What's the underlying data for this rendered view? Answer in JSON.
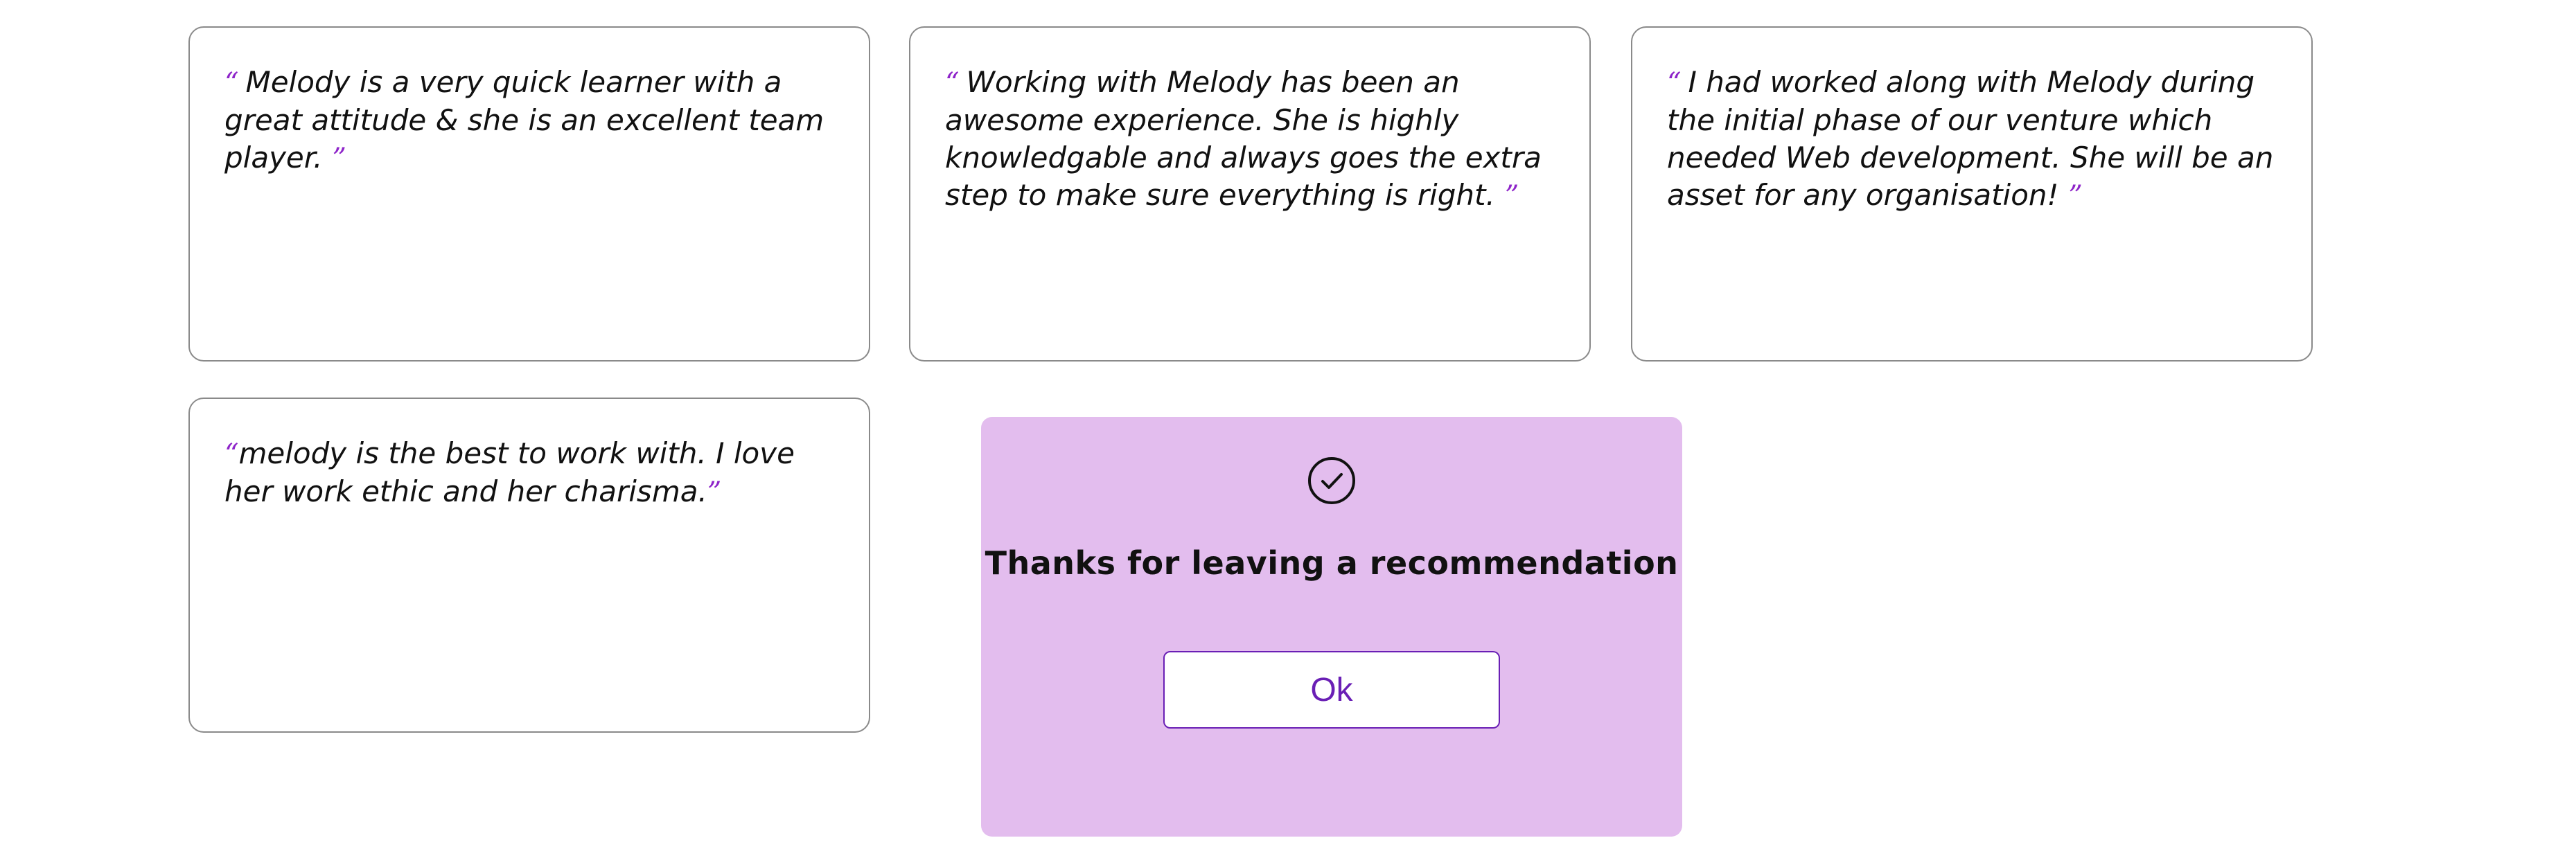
{
  "testimonials": [
    {
      "open_quote": "“",
      "text": "Melody is a very quick learner with a great attitude & she is an excellent team player.",
      "close_quote": "”"
    },
    {
      "open_quote": "“",
      "text": "Working with Melody has been an awesome experience. She is highly knowledgable and always goes the extra step to make sure everything is right.",
      "close_quote": "”"
    },
    {
      "open_quote": "“",
      "text": "I had worked along with Melody during the initial phase of our venture which needed Web development. She will be an asset for any organisation!",
      "close_quote": "”"
    },
    {
      "open_quote": "“",
      "text": "melody is the best to work with. I love her work ethic and her charisma.",
      "close_quote": "”"
    }
  ],
  "modal": {
    "icon": "check-circle-icon",
    "title": "Thanks for leaving a recommendation",
    "ok_label": "Ok"
  },
  "colors": {
    "accent": "#8e24c9",
    "modal_background": "#e3bdee",
    "button_text": "#6a1fb5",
    "card_border": "#8a8a8a"
  }
}
